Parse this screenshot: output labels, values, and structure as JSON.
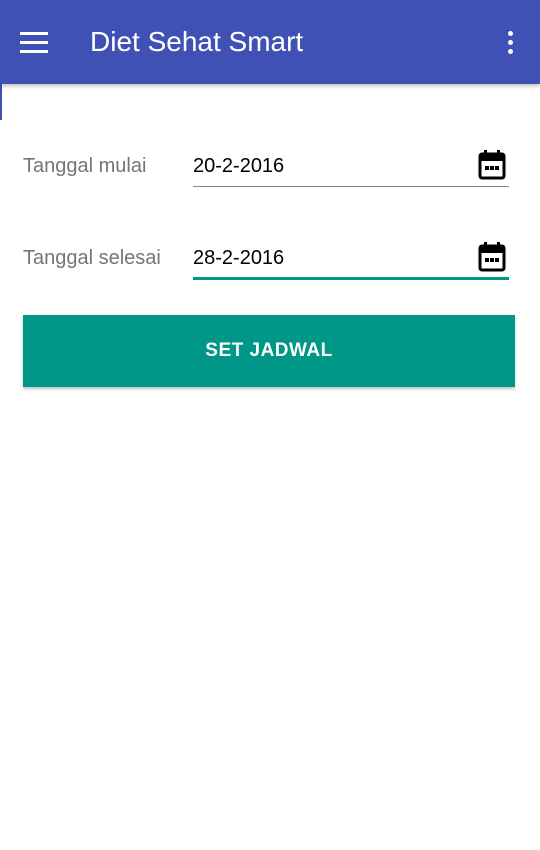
{
  "app_bar": {
    "title": "Diet Sehat Smart",
    "background": "#3f51b5",
    "menu_icon": "menu-icon",
    "overflow_icon": "more-vert-icon"
  },
  "form": {
    "start": {
      "label": "Tanggal mulai",
      "value": "20-2-2016",
      "icon": "calendar-icon"
    },
    "end": {
      "label": "Tanggal selesai",
      "value": "28-2-2016",
      "icon": "calendar-icon",
      "focused": true
    }
  },
  "button": {
    "label": "SET JADWAL",
    "color": "#009688"
  }
}
